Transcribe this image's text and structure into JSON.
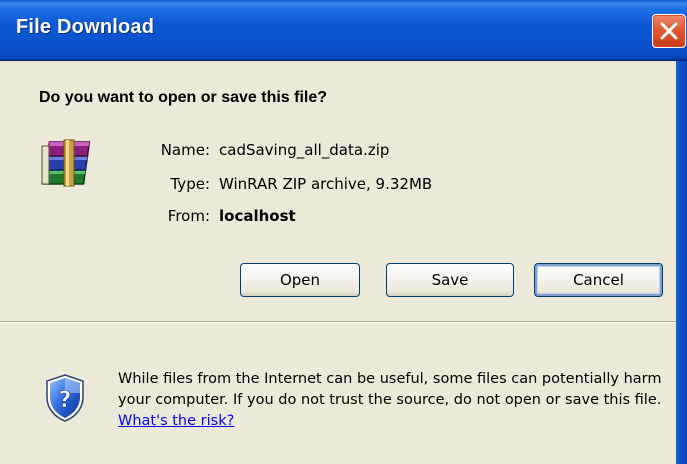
{
  "window": {
    "title": "File Download"
  },
  "dialog": {
    "question": "Do you want to open or save this file?",
    "file": {
      "icon": "winrar-archive-icon",
      "name_label": "Name:",
      "name_value": "cadSaving_all_data.zip",
      "type_label": "Type:",
      "type_value": "WinRAR ZIP archive, 9.32MB",
      "from_label": "From:",
      "from_value": "localhost"
    },
    "buttons": {
      "open": "Open",
      "save": "Save",
      "cancel": "Cancel"
    },
    "warning": {
      "icon": "security-shield-question-icon",
      "text": "While files from the Internet can be useful, some files can potentially harm your computer. If you do not trust the source, do not open or save this file. ",
      "link": "What's the risk?"
    }
  },
  "colors": {
    "titlebar": "#0a53cd",
    "client_bg": "#ece9d8",
    "close_button": "#e25a33",
    "link": "#0000ee"
  }
}
